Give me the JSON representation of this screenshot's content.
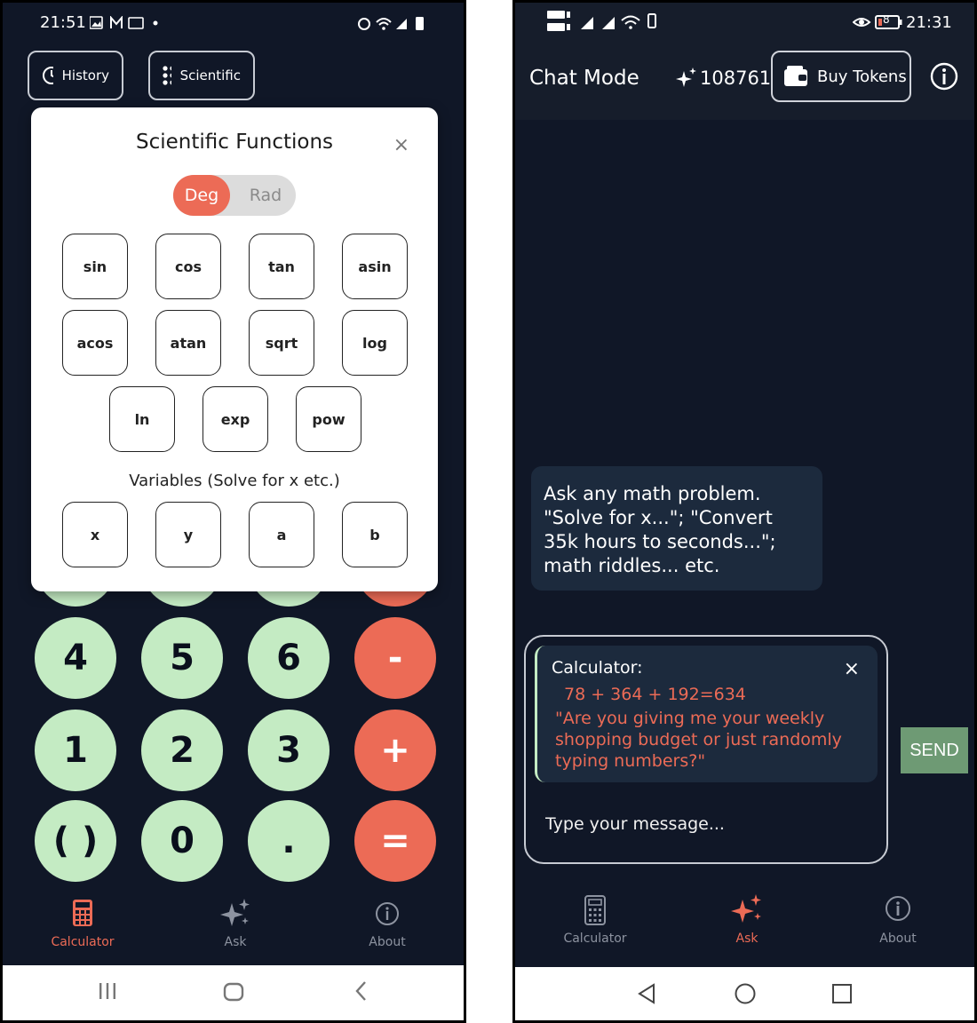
{
  "left": {
    "status": {
      "time": "21:51"
    },
    "top_buttons": {
      "history": "History",
      "scientific": "Scientific"
    },
    "modal": {
      "title": "Scientific Functions",
      "close": "×",
      "toggle": {
        "deg": "Deg",
        "rad": "Rad",
        "selected": "Deg"
      },
      "functions_row1": [
        "sin",
        "cos",
        "tan",
        "asin"
      ],
      "functions_row2": [
        "acos",
        "atan",
        "sqrt",
        "log"
      ],
      "functions_row3": [
        "ln",
        "exp",
        "pow"
      ],
      "variables_label": "Variables (Solve for x etc.)",
      "variables": [
        "x",
        "y",
        "a",
        "b"
      ]
    },
    "keypad": {
      "row1": [
        "4",
        "5",
        "6",
        "-"
      ],
      "row2": [
        "1",
        "2",
        "3",
        "+"
      ],
      "row3": [
        "( )",
        "0",
        ".",
        "="
      ]
    },
    "nav": {
      "calculator": "Calculator",
      "ask": "Ask",
      "about": "About",
      "active": "Calculator"
    }
  },
  "right": {
    "status": {
      "time": "21:31",
      "battery": "8"
    },
    "header": {
      "title": "Chat Mode",
      "tokens": "108761",
      "buy": "Buy Tokens"
    },
    "bubble": "Ask any math problem. \"Solve for x...\"; \"Convert 35k hours to seconds...\"; math riddles... etc.",
    "calc_card": {
      "label": "Calculator:",
      "expression": "78 + 364 + 192=634",
      "quote": "\"Are you giving me your weekly shopping budget or just randomly typing numbers?\"",
      "close": "×"
    },
    "input": {
      "placeholder": "Type your message..."
    },
    "send": "SEND",
    "nav": {
      "calculator": "Calculator",
      "ask": "Ask",
      "about": "About",
      "active": "Ask"
    }
  },
  "colors": {
    "accent": "#ec6b56",
    "key_green": "#c4ebc3",
    "bg": "#101727",
    "card": "#1c2a3d",
    "send": "#6e9a74"
  }
}
